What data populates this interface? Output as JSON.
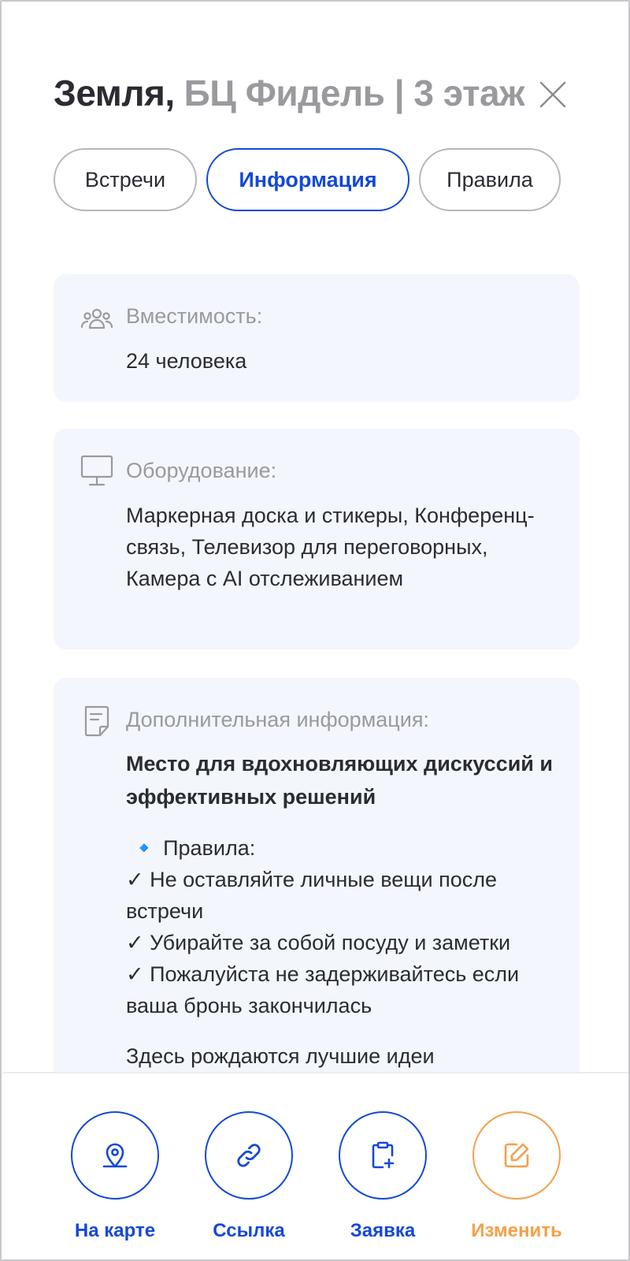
{
  "header": {
    "room_name": "Земля,",
    "location": "БЦ Фидель | 3 этаж"
  },
  "tabs": [
    {
      "label": "Встречи",
      "active": false
    },
    {
      "label": "Информация",
      "active": true
    },
    {
      "label": "Правила",
      "active": false
    }
  ],
  "cards": {
    "capacity": {
      "label": "Вместимость:",
      "value": "24 человека",
      "icon": "people-icon"
    },
    "equipment": {
      "label": "Оборудование:",
      "value": "Маркерная доска и стикеры, Конференц-связь, Телевизор для переговорных, Камера с AI отслеживанием",
      "icon": "monitor-icon"
    },
    "extra": {
      "label": "Дополнительная информация:",
      "icon": "document-icon",
      "headline": "Место для вдохновляющих дискуссий и эффективных решений",
      "rules_title": "🔹 Правила:",
      "rules": [
        "✓ Не оставляйте личные вещи после встречи",
        "✓ Убирайте за собой посуду и заметки",
        "✓ Пожалуйста не задерживайтесь если ваша бронь закончилась"
      ],
      "tail": "Здесь рождаются лучшие идеи"
    }
  },
  "actions": [
    {
      "label": "На карте",
      "icon": "map-pin-icon"
    },
    {
      "label": "Ссылка",
      "icon": "link-icon"
    },
    {
      "label": "Заявка",
      "icon": "clipboard-plus-icon"
    },
    {
      "label": "Изменить",
      "icon": "edit-icon"
    }
  ],
  "colors": {
    "accent": "#1449d6",
    "edit": "#f4a04a",
    "muted": "#9a9a9e",
    "card_bg": "#f3f6fc"
  }
}
